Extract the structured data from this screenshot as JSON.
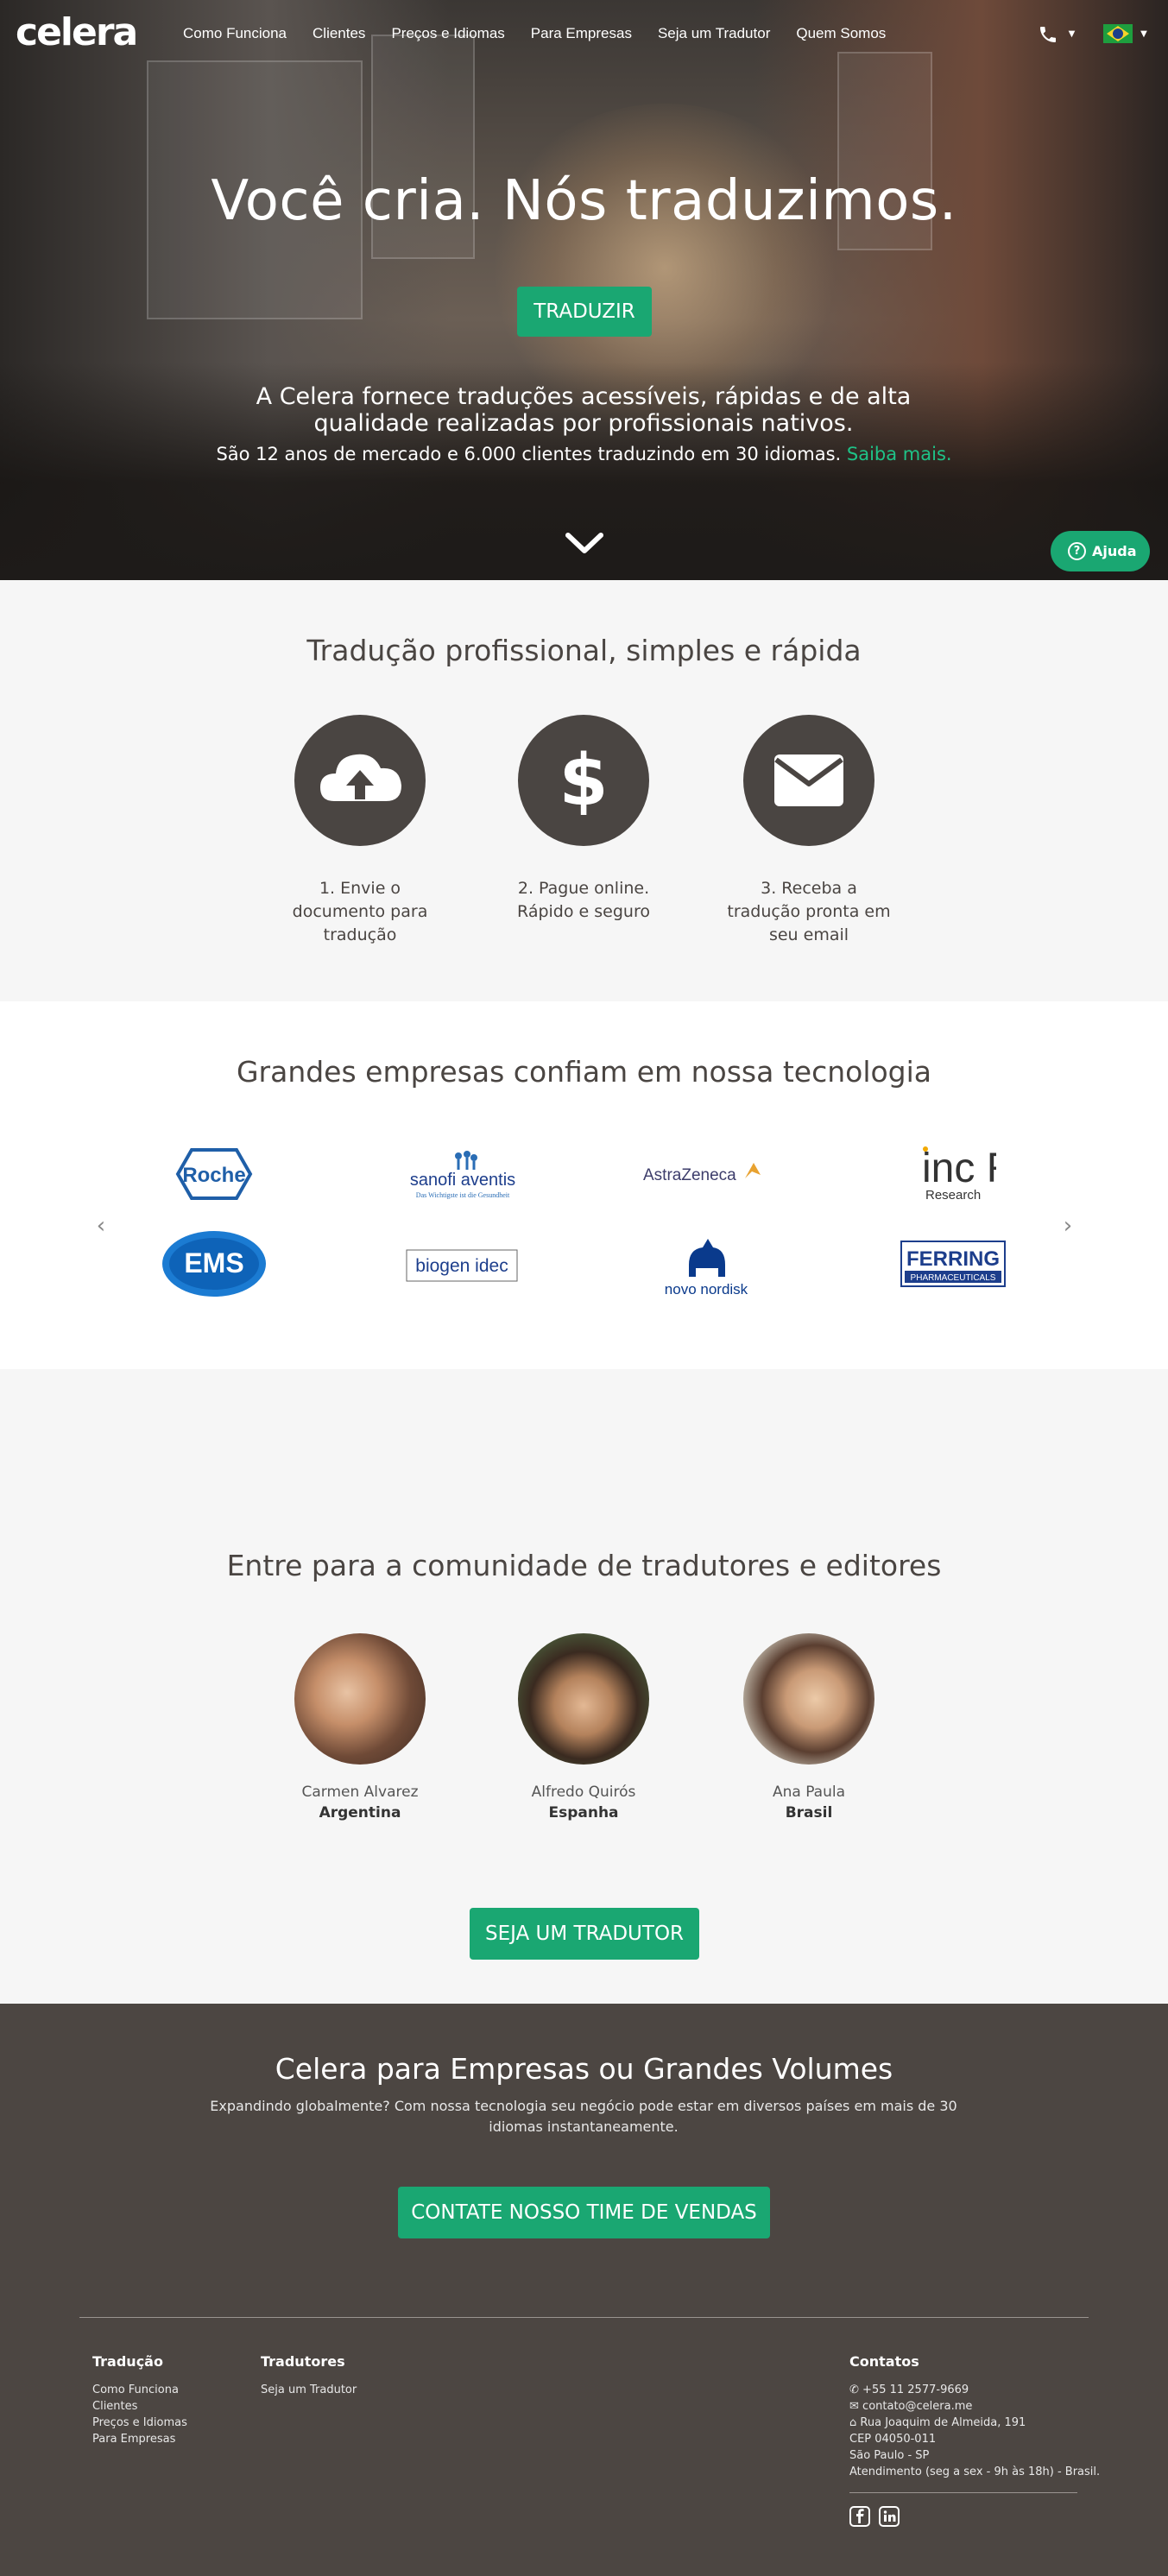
{
  "nav": {
    "logo": "celera",
    "links": [
      "Como Funciona",
      "Clientes",
      "Preços e Idiomas",
      "Para Empresas",
      "Seja um Tradutor",
      "Quem Somos"
    ],
    "phone_icon": "phone-icon",
    "language_flag": "brazil-flag-icon"
  },
  "hero": {
    "title": "Você cria. Nós traduzimos.",
    "cta": "TRADUZIR",
    "subtitle": "A Celera fornece traduções acessíveis, rápidas e de alta qualidade realizadas por profissionais nativos.",
    "subtitle2": "São 12 anos de mercado e 6.000 clientes traduzindo em 30 idiomas.",
    "subtitle2_link": "Saiba mais.",
    "help_button": "Ajuda"
  },
  "steps": {
    "title": "Tradução profissional, simples e rápida",
    "items": [
      {
        "icon": "cloud-upload-icon",
        "label": "1. Envie o documento para tradução"
      },
      {
        "icon": "dollar-icon",
        "label": "2. Pague online. Rápido e seguro"
      },
      {
        "icon": "envelope-icon",
        "label": "3. Receba a tradução pronta em seu email"
      }
    ]
  },
  "clients": {
    "title": "Grandes empresas confiam em nossa tecnologia",
    "logos": [
      "Roche",
      "sanofi aventis",
      "AstraZeneca",
      "inc Research",
      "EMS",
      "biogen idec",
      "novo nordisk",
      "FERRING"
    ],
    "sanofi_tagline": "Das Wichtigste ist die Gesundheit",
    "ferring_sub": "PHARMACEUTICALS",
    "inc_sub": "Research"
  },
  "community": {
    "title": "Entre para a comunidade de tradutores e editores",
    "people": [
      {
        "name": "Carmen Alvarez",
        "country": "Argentina"
      },
      {
        "name": "Alfredo Quirós",
        "country": "Espanha"
      },
      {
        "name": "Ana Paula",
        "country": "Brasil"
      }
    ],
    "cta": "SEJA UM TRADUTOR"
  },
  "enterprise": {
    "title": "Celera para Empresas ou Grandes Volumes",
    "description": "Expandindo globalmente? Com nossa tecnologia seu negócio pode estar em diversos países em mais de 30 idiomas instantaneamente.",
    "cta": "CONTATE NOSSO TIME DE VENDAS"
  },
  "footer": {
    "traducao": {
      "title": "Tradução",
      "links": [
        "Como Funciona",
        "Clientes",
        "Preços e Idiomas",
        "Para Empresas"
      ]
    },
    "tradutores": {
      "title": "Tradutores",
      "links": [
        "Seja um Tradutor"
      ]
    },
    "contatos": {
      "title": "Contatos",
      "phone": "+55 11 2577-9669",
      "email": "contato@celera.me",
      "address": "Rua Joaquim de Almeida, 191",
      "cep": "CEP 04050-011",
      "city": "São Paulo - SP",
      "hours": "Atendimento (seg a sex - 9h às 18h) - Brasil."
    }
  },
  "colors": {
    "accent": "#1aa772",
    "dark": "#4a4542",
    "footer_bg": "#4c4642",
    "link_green": "#1fc287"
  }
}
